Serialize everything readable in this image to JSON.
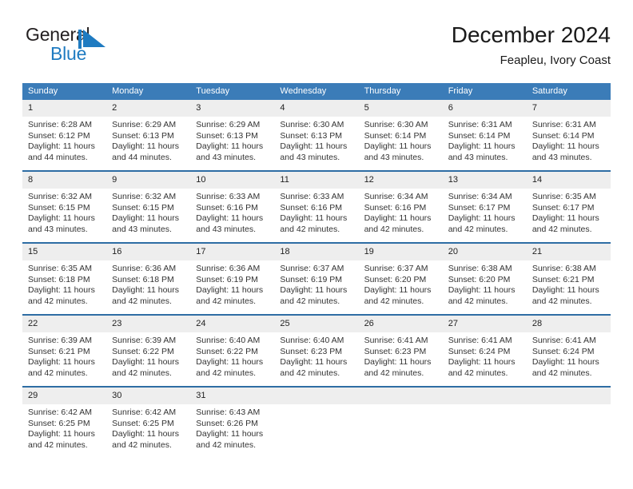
{
  "brand": {
    "name_part1": "General",
    "name_part2": "Blue",
    "accent_color": "#1f7bc1",
    "flag_icon": "triangle-flag-icon"
  },
  "header": {
    "title": "December 2024",
    "subtitle": "Feapleu, Ivory Coast"
  },
  "colors": {
    "header_band": "#3b7cb8",
    "row_separator": "#2e6da4",
    "daynum_band": "#eeeeee"
  },
  "weekday_headers": [
    "Sunday",
    "Monday",
    "Tuesday",
    "Wednesday",
    "Thursday",
    "Friday",
    "Saturday"
  ],
  "weeks": [
    [
      {
        "day": "1",
        "sunrise": "Sunrise: 6:28 AM",
        "sunset": "Sunset: 6:12 PM",
        "daylight_line1": "Daylight: 11 hours",
        "daylight_line2": "and 44 minutes."
      },
      {
        "day": "2",
        "sunrise": "Sunrise: 6:29 AM",
        "sunset": "Sunset: 6:13 PM",
        "daylight_line1": "Daylight: 11 hours",
        "daylight_line2": "and 44 minutes."
      },
      {
        "day": "3",
        "sunrise": "Sunrise: 6:29 AM",
        "sunset": "Sunset: 6:13 PM",
        "daylight_line1": "Daylight: 11 hours",
        "daylight_line2": "and 43 minutes."
      },
      {
        "day": "4",
        "sunrise": "Sunrise: 6:30 AM",
        "sunset": "Sunset: 6:13 PM",
        "daylight_line1": "Daylight: 11 hours",
        "daylight_line2": "and 43 minutes."
      },
      {
        "day": "5",
        "sunrise": "Sunrise: 6:30 AM",
        "sunset": "Sunset: 6:14 PM",
        "daylight_line1": "Daylight: 11 hours",
        "daylight_line2": "and 43 minutes."
      },
      {
        "day": "6",
        "sunrise": "Sunrise: 6:31 AM",
        "sunset": "Sunset: 6:14 PM",
        "daylight_line1": "Daylight: 11 hours",
        "daylight_line2": "and 43 minutes."
      },
      {
        "day": "7",
        "sunrise": "Sunrise: 6:31 AM",
        "sunset": "Sunset: 6:14 PM",
        "daylight_line1": "Daylight: 11 hours",
        "daylight_line2": "and 43 minutes."
      }
    ],
    [
      {
        "day": "8",
        "sunrise": "Sunrise: 6:32 AM",
        "sunset": "Sunset: 6:15 PM",
        "daylight_line1": "Daylight: 11 hours",
        "daylight_line2": "and 43 minutes."
      },
      {
        "day": "9",
        "sunrise": "Sunrise: 6:32 AM",
        "sunset": "Sunset: 6:15 PM",
        "daylight_line1": "Daylight: 11 hours",
        "daylight_line2": "and 43 minutes."
      },
      {
        "day": "10",
        "sunrise": "Sunrise: 6:33 AM",
        "sunset": "Sunset: 6:16 PM",
        "daylight_line1": "Daylight: 11 hours",
        "daylight_line2": "and 43 minutes."
      },
      {
        "day": "11",
        "sunrise": "Sunrise: 6:33 AM",
        "sunset": "Sunset: 6:16 PM",
        "daylight_line1": "Daylight: 11 hours",
        "daylight_line2": "and 42 minutes."
      },
      {
        "day": "12",
        "sunrise": "Sunrise: 6:34 AM",
        "sunset": "Sunset: 6:16 PM",
        "daylight_line1": "Daylight: 11 hours",
        "daylight_line2": "and 42 minutes."
      },
      {
        "day": "13",
        "sunrise": "Sunrise: 6:34 AM",
        "sunset": "Sunset: 6:17 PM",
        "daylight_line1": "Daylight: 11 hours",
        "daylight_line2": "and 42 minutes."
      },
      {
        "day": "14",
        "sunrise": "Sunrise: 6:35 AM",
        "sunset": "Sunset: 6:17 PM",
        "daylight_line1": "Daylight: 11 hours",
        "daylight_line2": "and 42 minutes."
      }
    ],
    [
      {
        "day": "15",
        "sunrise": "Sunrise: 6:35 AM",
        "sunset": "Sunset: 6:18 PM",
        "daylight_line1": "Daylight: 11 hours",
        "daylight_line2": "and 42 minutes."
      },
      {
        "day": "16",
        "sunrise": "Sunrise: 6:36 AM",
        "sunset": "Sunset: 6:18 PM",
        "daylight_line1": "Daylight: 11 hours",
        "daylight_line2": "and 42 minutes."
      },
      {
        "day": "17",
        "sunrise": "Sunrise: 6:36 AM",
        "sunset": "Sunset: 6:19 PM",
        "daylight_line1": "Daylight: 11 hours",
        "daylight_line2": "and 42 minutes."
      },
      {
        "day": "18",
        "sunrise": "Sunrise: 6:37 AM",
        "sunset": "Sunset: 6:19 PM",
        "daylight_line1": "Daylight: 11 hours",
        "daylight_line2": "and 42 minutes."
      },
      {
        "day": "19",
        "sunrise": "Sunrise: 6:37 AM",
        "sunset": "Sunset: 6:20 PM",
        "daylight_line1": "Daylight: 11 hours",
        "daylight_line2": "and 42 minutes."
      },
      {
        "day": "20",
        "sunrise": "Sunrise: 6:38 AM",
        "sunset": "Sunset: 6:20 PM",
        "daylight_line1": "Daylight: 11 hours",
        "daylight_line2": "and 42 minutes."
      },
      {
        "day": "21",
        "sunrise": "Sunrise: 6:38 AM",
        "sunset": "Sunset: 6:21 PM",
        "daylight_line1": "Daylight: 11 hours",
        "daylight_line2": "and 42 minutes."
      }
    ],
    [
      {
        "day": "22",
        "sunrise": "Sunrise: 6:39 AM",
        "sunset": "Sunset: 6:21 PM",
        "daylight_line1": "Daylight: 11 hours",
        "daylight_line2": "and 42 minutes."
      },
      {
        "day": "23",
        "sunrise": "Sunrise: 6:39 AM",
        "sunset": "Sunset: 6:22 PM",
        "daylight_line1": "Daylight: 11 hours",
        "daylight_line2": "and 42 minutes."
      },
      {
        "day": "24",
        "sunrise": "Sunrise: 6:40 AM",
        "sunset": "Sunset: 6:22 PM",
        "daylight_line1": "Daylight: 11 hours",
        "daylight_line2": "and 42 minutes."
      },
      {
        "day": "25",
        "sunrise": "Sunrise: 6:40 AM",
        "sunset": "Sunset: 6:23 PM",
        "daylight_line1": "Daylight: 11 hours",
        "daylight_line2": "and 42 minutes."
      },
      {
        "day": "26",
        "sunrise": "Sunrise: 6:41 AM",
        "sunset": "Sunset: 6:23 PM",
        "daylight_line1": "Daylight: 11 hours",
        "daylight_line2": "and 42 minutes."
      },
      {
        "day": "27",
        "sunrise": "Sunrise: 6:41 AM",
        "sunset": "Sunset: 6:24 PM",
        "daylight_line1": "Daylight: 11 hours",
        "daylight_line2": "and 42 minutes."
      },
      {
        "day": "28",
        "sunrise": "Sunrise: 6:41 AM",
        "sunset": "Sunset: 6:24 PM",
        "daylight_line1": "Daylight: 11 hours",
        "daylight_line2": "and 42 minutes."
      }
    ],
    [
      {
        "day": "29",
        "sunrise": "Sunrise: 6:42 AM",
        "sunset": "Sunset: 6:25 PM",
        "daylight_line1": "Daylight: 11 hours",
        "daylight_line2": "and 42 minutes."
      },
      {
        "day": "30",
        "sunrise": "Sunrise: 6:42 AM",
        "sunset": "Sunset: 6:25 PM",
        "daylight_line1": "Daylight: 11 hours",
        "daylight_line2": "and 42 minutes."
      },
      {
        "day": "31",
        "sunrise": "Sunrise: 6:43 AM",
        "sunset": "Sunset: 6:26 PM",
        "daylight_line1": "Daylight: 11 hours",
        "daylight_line2": "and 42 minutes."
      },
      {
        "day": "",
        "sunrise": "",
        "sunset": "",
        "daylight_line1": "",
        "daylight_line2": ""
      },
      {
        "day": "",
        "sunrise": "",
        "sunset": "",
        "daylight_line1": "",
        "daylight_line2": ""
      },
      {
        "day": "",
        "sunrise": "",
        "sunset": "",
        "daylight_line1": "",
        "daylight_line2": ""
      },
      {
        "day": "",
        "sunrise": "",
        "sunset": "",
        "daylight_line1": "",
        "daylight_line2": ""
      }
    ]
  ]
}
